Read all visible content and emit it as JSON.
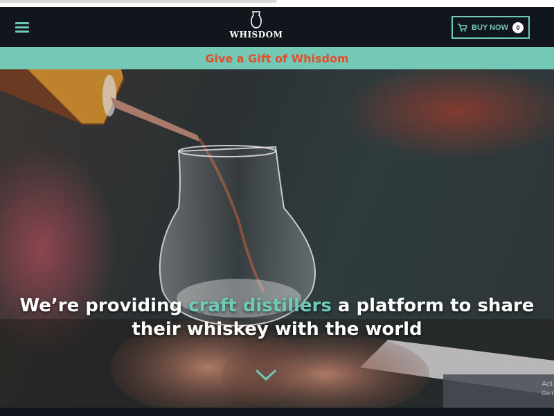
{
  "header": {
    "menu_icon": "hamburger-menu-icon",
    "logo_icon": "glencairn-glass-icon",
    "logo_text": "WHISDOM",
    "buy_label": "BUY NOW",
    "cart_icon": "shopping-cart-icon",
    "cart_count": "0"
  },
  "promo": {
    "text": "Give a Gift of Whisdom"
  },
  "hero": {
    "headline_part1": "We’re providing ",
    "headline_accent": "craft distillers",
    "headline_part2": " a platform to share their whiskey with the world",
    "scroll_icon": "chevron-down-icon"
  },
  "watermark": {
    "line1": "Act",
    "line2": "Go t"
  },
  "colors": {
    "navbar_bg": "#11151c",
    "accent_teal": "#6ecbb7",
    "promo_bg": "#73c9b6",
    "promo_text": "#e24d2a",
    "text_white": "#ffffff"
  }
}
